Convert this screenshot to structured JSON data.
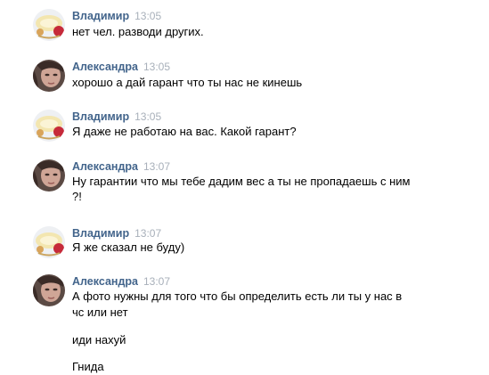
{
  "messages": [
    {
      "author": "Владимир",
      "time": "13:05",
      "avatar": "vladimir",
      "lines": [
        "нет чел. разводи других."
      ]
    },
    {
      "author": "Александра",
      "time": "13:05",
      "avatar": "alexandra",
      "lines": [
        "хорошо а дай гарант что ты нас не кинешь"
      ]
    },
    {
      "author": "Владимир",
      "time": "13:05",
      "avatar": "vladimir",
      "lines": [
        "Я даже не работаю на вас. Какой гарант?"
      ]
    },
    {
      "author": "Александра",
      "time": "13:07",
      "avatar": "alexandra",
      "lines": [
        "Ну гарантии что мы тебе дадим вес а ты не пропадаешь с ним",
        "?!"
      ]
    },
    {
      "author": "Владимир",
      "time": "13:07",
      "avatar": "vladimir",
      "lines": [
        "Я же сказал не буду)"
      ]
    },
    {
      "author": "Александра",
      "time": "13:07",
      "avatar": "alexandra",
      "lines": [
        "А фото нужны для того что бы определить есть ли ты у нас в",
        "чс или нет",
        "иди нахуй",
        "Гнида"
      ]
    }
  ],
  "colors": {
    "author": "#42648b",
    "time": "#a8b0ba",
    "text": "#000000"
  }
}
